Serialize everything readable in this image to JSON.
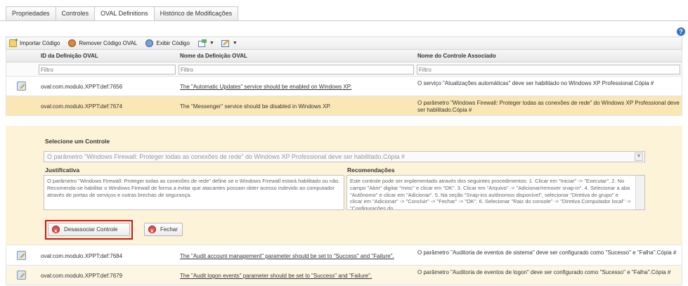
{
  "tabs": [
    {
      "label": "Propriedades",
      "active": false
    },
    {
      "label": "Controles",
      "active": false
    },
    {
      "label": "OVAL Definitions",
      "active": true
    },
    {
      "label": "Histórico de Modificações",
      "active": false
    }
  ],
  "help_label": "?",
  "toolbar": {
    "import_label": "Importar Código",
    "remove_label": "Remover Código OVAL",
    "view_label": "Exibir Código"
  },
  "columns": {
    "id": "ID da Definição OVAL",
    "name": "Nome da Definição OVAL",
    "control": "Nome do Controle Associado"
  },
  "filter_placeholder": "Filtro",
  "rows_top": [
    {
      "id": "oval:com.modulo.XPPT:def:7656",
      "name": "The \"Automatic Updates\" service should be enabled on Windows XP.",
      "control": "O serviço \"Atualizações automáticas\" deve ser habilitado no Windows XP Professional.Cópia #"
    },
    {
      "id": "oval:com.modulo.XPPT:def:7674",
      "name": "The \"Messenger\" service should be disabled in Windows XP.",
      "control": "O parâmetro \"Windows Firewall: Proteger todas as conexões de rede\" do Windows XP Professional deve ser habilitado.Cópia #"
    }
  ],
  "detail": {
    "select_label": "Selecione um Controle",
    "select_value": "O parâmetro \"Windows Firewall: Proteger todas as conexões de rede\" do Windows XP Professional deve ser habilitado.Cópia #",
    "justification_label": "Justificativa",
    "justification_text": "O parâmetro \"Windows Firewall: Proteger todas as conexões de rede\" define se o Windows Firewall estará habilitado ou não. Recomenda-se habilitar o Windows Firewall de forma a evitar que atacantes possam obter acesso indevido ao computador através de portas de serviços e outras brechas de segurança.",
    "recommendations_label": "Recomendações",
    "recommendations_text": "Este controle pode ser implementado através dos seguintes procedimentos: 1. Clicar em \"Iniciar\" -> \"Executar\". 2. No campo \"Abrir\" digitar \"mmc\" e clicar em \"OK\". 3. Clicar em \"Arquivo\" -> \"Adicionar/remover snap-in\". 4. Selecionar a aba \"Autônomo\" e clicar em \"Adicionar\". 5. Na seção \"Snap-ins autônomos disponível\", selecionar \"Diretiva de grupo\" e clicar em \"Adicionar\" -> \"Concluir\" -> \"Fechar\" -> \"OK\". 6. Selecionar \"Raiz do console\" -> \"Diretiva Computador local\" -> \"Configurações do",
    "dissociate_label": "Desassociar Controle",
    "close_label": "Fechar"
  },
  "rows_bottom": [
    {
      "id": "oval:com.modulo.XPPT:def:7684",
      "name": "The \"Audit account management\" parameter should be set to \"Success\" and \"Failure\".",
      "control": "O parâmetro \"Auditoria de eventos de sistema\" deve ser configurado como \"Sucesso\" e \"Falha\".Cópia #"
    },
    {
      "id": "oval:com.modulo.XPPT:def:7679",
      "name": "The \"Audit logon events\" parameter should be set to \"Success\" and \"Failure\".",
      "control": "O parâmetro \"Auditoria de eventos de logon\" deve ser configurado como \"Sucesso\" e \"Falha\".Cópia #"
    }
  ],
  "colors": {
    "selected_row": "#fbe7b6",
    "detail_bg": "#fdf3d8",
    "highlight": "#d0151b"
  }
}
